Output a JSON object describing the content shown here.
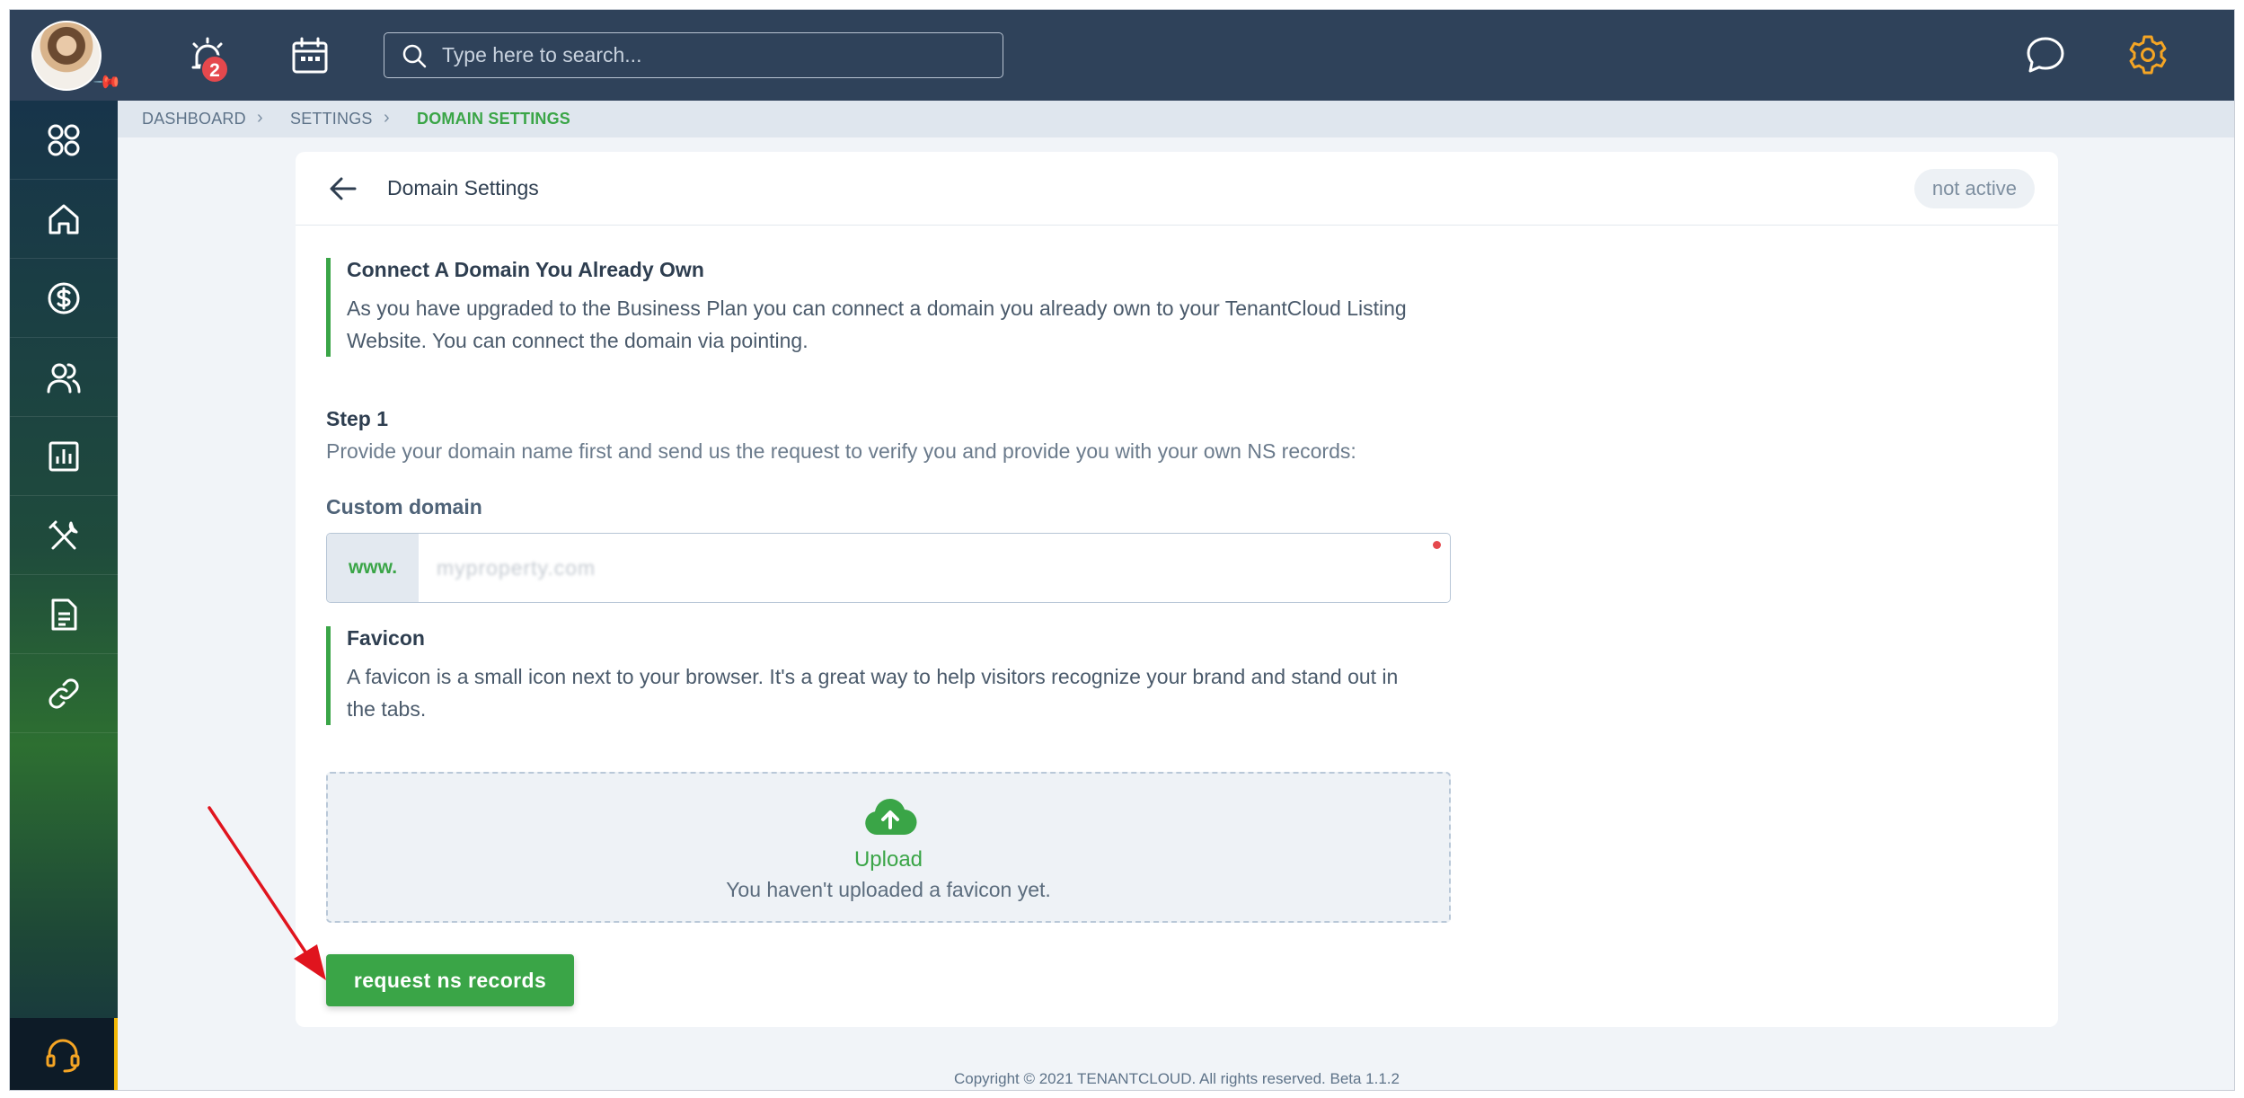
{
  "topbar": {
    "avatar_alt": "",
    "notifications_badge": "2",
    "search_placeholder": "Type here to search..."
  },
  "sidebar": {
    "items": [
      {
        "icon": "apps-grid-icon"
      },
      {
        "icon": "home-icon"
      },
      {
        "icon": "dollar-icon"
      },
      {
        "icon": "users-icon"
      },
      {
        "icon": "reports-chart-icon"
      },
      {
        "icon": "maintenance-tools-icon"
      },
      {
        "icon": "document-icon"
      },
      {
        "icon": "link-icon"
      }
    ],
    "support_icon": "headset-icon"
  },
  "breadcrumb": {
    "items": [
      "DASHBOARD",
      "SETTINGS",
      "DOMAIN SETTINGS"
    ]
  },
  "card": {
    "title": "Domain Settings",
    "status": "not active",
    "connect": {
      "title": "Connect A Domain You Already Own",
      "line1": "As you have upgraded to the Business Plan you can connect a domain you already own to your TenantCloud Listing",
      "line2": "Website. You can connect the domain via pointing."
    },
    "step": {
      "title": "Step 1",
      "text": "Provide your domain name first and send us the request to verify you and provide you with your own NS records:"
    },
    "custom_domain": {
      "label": "Custom domain",
      "prefix": "www.",
      "value": "myproperty.com"
    },
    "favicon": {
      "title": "Favicon",
      "line1": "A favicon is a small icon next to your browser. It's a great way to help visitors recognize your brand and stand out in",
      "line2": "the tabs."
    },
    "upload": {
      "label": "Upload",
      "hint": "You haven't uploaded a favicon yet."
    },
    "request_button": "request ns records"
  },
  "footer": {
    "copyright": "Copyright © 2021 TENANTCLOUD. All rights reserved. Beta 1.1.2"
  },
  "colors": {
    "topbar": "#2f425a",
    "accent_green": "#3aa547",
    "settings_orange": "#f5a524",
    "badge_red": "#e5484d",
    "annotation_arrow": "#e0141e"
  }
}
